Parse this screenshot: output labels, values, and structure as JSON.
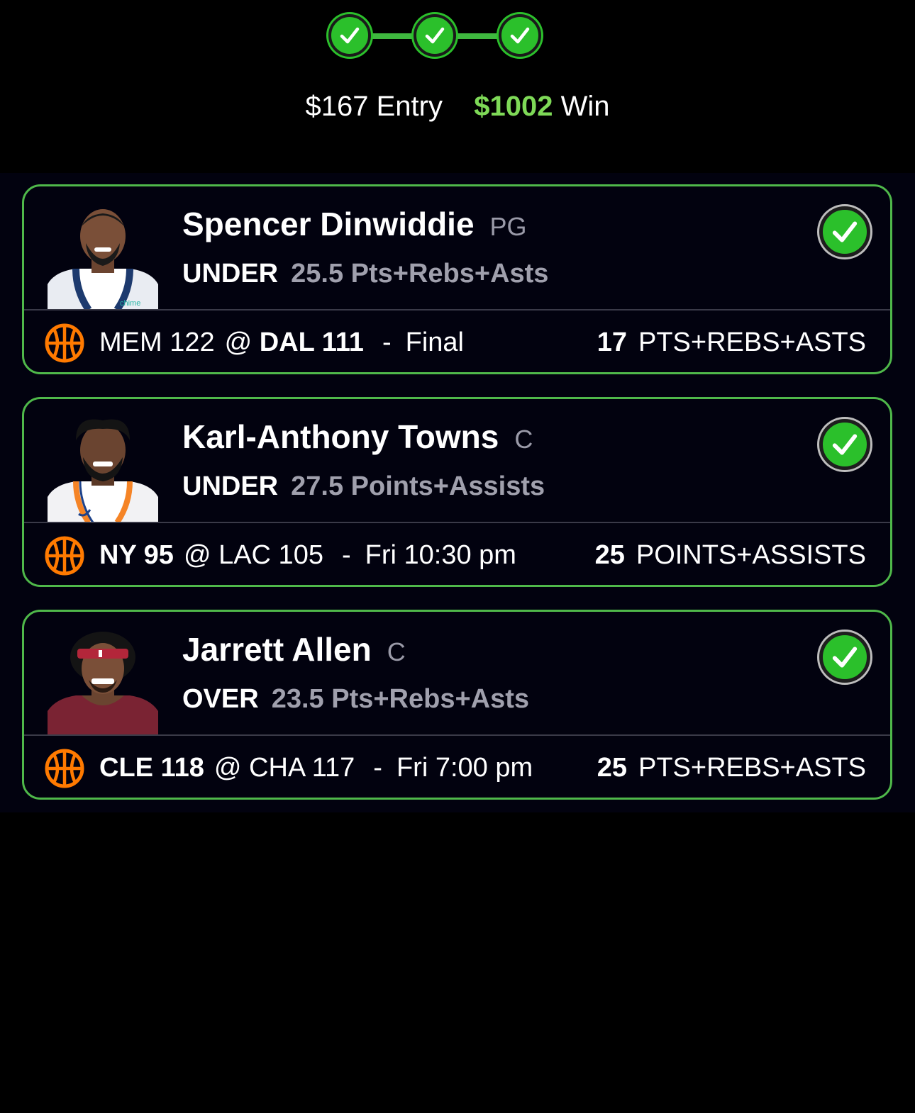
{
  "progress": {
    "steps": [
      "complete",
      "complete",
      "complete"
    ]
  },
  "summary": {
    "entry_amount": "$167",
    "entry_label": "Entry",
    "win_amount": "$1002",
    "win_label": "Win",
    "win_color": "#7ed957"
  },
  "colors": {
    "accent": "#4fb84a",
    "check": "#2bc02b",
    "ball": "#ff7a00"
  },
  "picks": [
    {
      "name": "Spencer Dinwiddie",
      "position": "PG",
      "direction": "UNDER",
      "line": "25.5 Pts+Rebs+Asts",
      "away": "MEM 122",
      "at": "@",
      "home": "DAL 111",
      "dash": "-",
      "status": "Final",
      "actual_value": "17",
      "actual_label": "PTS+REBS+ASTS",
      "jersey_text": "chime",
      "result": "hit"
    },
    {
      "name": "Karl-Anthony Towns",
      "position": "C",
      "direction": "UNDER",
      "line": "27.5 Points+Assists",
      "away": "NY 95",
      "at": "@",
      "home": "LAC 105",
      "dash": "-",
      "status": "Fri 10:30 pm",
      "actual_value": "25",
      "actual_label": "POINTS+ASSISTS",
      "result": "hit"
    },
    {
      "name": "Jarrett Allen",
      "position": "C",
      "direction": "OVER",
      "line": "23.5 Pts+Rebs+Asts",
      "away": "CLE 118",
      "at": "@",
      "home": "CHA 117",
      "dash": "-",
      "status": "Fri 7:00 pm",
      "actual_value": "25",
      "actual_label": "PTS+REBS+ASTS",
      "result": "hit"
    }
  ]
}
